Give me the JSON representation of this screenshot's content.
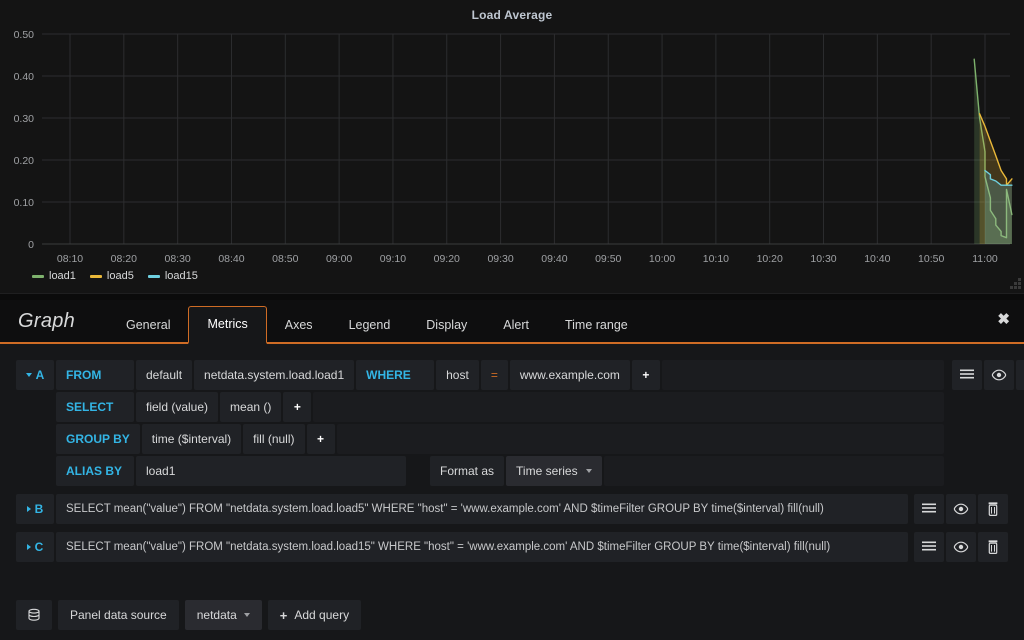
{
  "panel": {
    "title": "Load Average",
    "resize_handle_icon": "resize-grip-icon"
  },
  "chart_data": {
    "type": "line",
    "title": "Load Average",
    "xlabel": "",
    "ylabel": "",
    "grid": true,
    "legend_position": "bottom-left",
    "ylim": [
      0,
      0.5
    ],
    "yticks": [
      "0",
      "0.10",
      "0.20",
      "0.30",
      "0.40",
      "0.50"
    ],
    "ytick_values": [
      0,
      0.1,
      0.2,
      0.3,
      0.4,
      0.5
    ],
    "xticks": [
      "08:10",
      "08:20",
      "08:30",
      "08:40",
      "08:50",
      "09:00",
      "09:10",
      "09:20",
      "09:30",
      "09:40",
      "09:50",
      "10:00",
      "10:10",
      "10:20",
      "10:30",
      "10:40",
      "10:50",
      "11:00"
    ],
    "xlim_labels": [
      "08:10",
      "11:05"
    ],
    "colors": {
      "load1": "#7eb26d",
      "load5": "#eab839",
      "load15": "#6ed0e0"
    },
    "series": [
      {
        "name": "load1",
        "color": "#7eb26d",
        "x": [
          "10:58",
          "10:59",
          "11:00",
          "11:00",
          "11:01",
          "11:01",
          "11:02",
          "11:02",
          "11:03",
          "11:03",
          "11:04",
          "11:04",
          "11:05"
        ],
        "values": [
          0.44,
          0.3,
          0.22,
          0.16,
          0.11,
          0.08,
          0.06,
          0.045,
          0.03,
          0.02,
          0.015,
          0.13,
          0.07
        ]
      },
      {
        "name": "load5",
        "color": "#eab839",
        "x": [
          "10:59",
          "11:00",
          "11:01",
          "11:02",
          "11:03",
          "11:04",
          "11:04",
          "11:05"
        ],
        "values": [
          0.31,
          0.28,
          0.245,
          0.21,
          0.175,
          0.155,
          0.14,
          0.155
        ]
      },
      {
        "name": "load15",
        "color": "#6ed0e0",
        "x": [
          "11:00",
          "11:01",
          "11:01",
          "11:02",
          "11:03",
          "11:04",
          "11:05"
        ],
        "values": [
          0.175,
          0.165,
          0.155,
          0.15,
          0.14,
          0.14,
          0.14
        ]
      }
    ],
    "legend": [
      {
        "label": "load1",
        "color": "#7eb26d"
      },
      {
        "label": "load5",
        "color": "#eab839"
      },
      {
        "label": "load15",
        "color": "#6ed0e0"
      }
    ]
  },
  "editor": {
    "kind": "Graph",
    "close_label": "✖",
    "tabs": [
      {
        "label": "General",
        "active": false
      },
      {
        "label": "Metrics",
        "active": true
      },
      {
        "label": "Axes",
        "active": false
      },
      {
        "label": "Legend",
        "active": false
      },
      {
        "label": "Display",
        "active": false
      },
      {
        "label": "Alert",
        "active": false
      },
      {
        "label": "Time range",
        "active": false
      }
    ],
    "queries": [
      {
        "letter": "A",
        "expanded": true,
        "from": {
          "key": "FROM",
          "policy": "default",
          "measurement": "netdata.system.load.load1",
          "where_key": "WHERE",
          "where_field": "host",
          "where_op": "=",
          "where_value": "www.example.com",
          "add": "+"
        },
        "select": {
          "key": "SELECT",
          "parts": [
            "field (value)",
            "mean ()"
          ],
          "add": "+"
        },
        "group_by": {
          "key": "GROUP BY",
          "parts": [
            "time ($interval)",
            "fill (null)"
          ],
          "add": "+"
        },
        "alias": {
          "key": "ALIAS BY",
          "value": "load1",
          "format_label": "Format as",
          "format_value": "Time series"
        },
        "tools": [
          "hamburger-icon",
          "eye-icon",
          "trash-icon"
        ]
      },
      {
        "letter": "B",
        "expanded": false,
        "raw": "SELECT mean(\"value\") FROM \"netdata.system.load.load5\" WHERE \"host\" = 'www.example.com' AND $timeFilter GROUP BY time($interval) fill(null)",
        "tools": [
          "hamburger-icon",
          "eye-icon",
          "trash-icon"
        ]
      },
      {
        "letter": "C",
        "expanded": false,
        "raw": "SELECT mean(\"value\") FROM \"netdata.system.load.load15\" WHERE \"host\" = 'www.example.com' AND $timeFilter GROUP BY time($interval) fill(null)",
        "tools": [
          "hamburger-icon",
          "eye-icon",
          "trash-icon"
        ]
      }
    ],
    "footer": {
      "datasource_icon": "database-icon",
      "panel_datasource_label": "Panel data source",
      "datasource_value": "netdata",
      "add_query_label": "Add query",
      "add_query_icon": "plus-icon"
    }
  }
}
